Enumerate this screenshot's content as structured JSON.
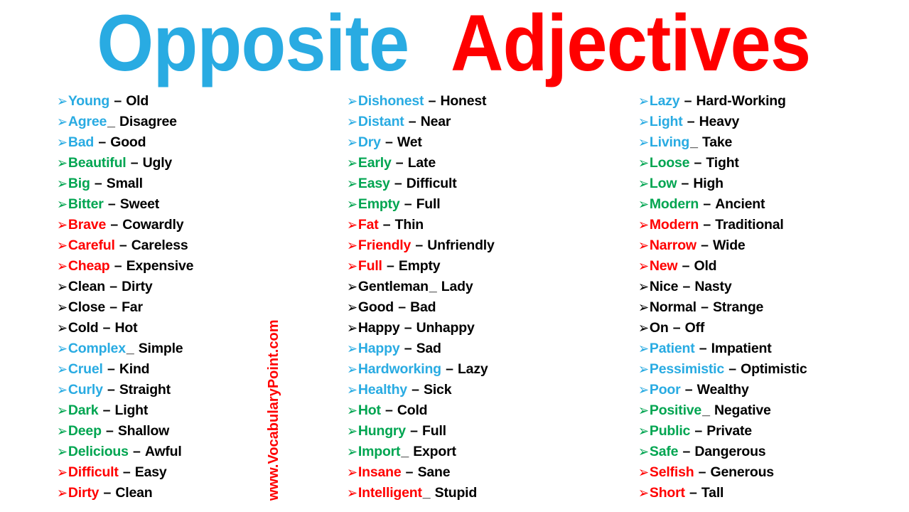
{
  "title": {
    "word_first": "Opposite",
    "word_second": "Adjectives",
    "color_first": "#29ABE2",
    "color_second": "#FF0000"
  },
  "watermark": {
    "text": "www.VocabularyPoint.com",
    "color": "#FF0000"
  },
  "bullet_glyph": "➢",
  "palette": {
    "blue": "#29ABE2",
    "green": "#00A551",
    "red": "#FF0000",
    "black": "#000000"
  },
  "columns": [
    {
      "name": "column-1",
      "rows": [
        {
          "word": "Young",
          "sep": "–",
          "opposite": "Old",
          "color": "blue"
        },
        {
          "word": "Agree",
          "sep": "_",
          "opposite": "Disagree",
          "color": "blue"
        },
        {
          "word": "Bad",
          "sep": "–",
          "opposite": "Good",
          "color": "blue"
        },
        {
          "word": "Beautiful",
          "sep": "–",
          "opposite": "Ugly",
          "color": "green"
        },
        {
          "word": "Big",
          "sep": "–",
          "opposite": "Small",
          "color": "green"
        },
        {
          "word": "Bitter",
          "sep": "–",
          "opposite": "Sweet",
          "color": "green"
        },
        {
          "word": "Brave",
          "sep": "–",
          "opposite": "Cowardly",
          "color": "red"
        },
        {
          "word": "Careful",
          "sep": "–",
          "opposite": "Careless",
          "color": "red"
        },
        {
          "word": "Cheap",
          "sep": "–",
          "opposite": "Expensive",
          "color": "red"
        },
        {
          "word": "Clean",
          "sep": "–",
          "opposite": "Dirty",
          "color": "black"
        },
        {
          "word": "Close",
          "sep": "–",
          "opposite": "Far",
          "color": "black"
        },
        {
          "word": "Cold",
          "sep": "–",
          "opposite": "Hot",
          "color": "black"
        },
        {
          "word": "Complex",
          "sep": "_",
          "opposite": "Simple",
          "color": "blue"
        },
        {
          "word": "Cruel",
          "sep": "–",
          "opposite": "Kind",
          "color": "blue"
        },
        {
          "word": "Curly",
          "sep": "–",
          "opposite": "Straight",
          "color": "blue"
        },
        {
          "word": "Dark",
          "sep": "–",
          "opposite": "Light",
          "color": "green"
        },
        {
          "word": "Deep",
          "sep": "–",
          "opposite": "Shallow",
          "color": "green"
        },
        {
          "word": "Delicious",
          "sep": "–",
          "opposite": "Awful",
          "color": "green"
        },
        {
          "word": "Difficult",
          "sep": "–",
          "opposite": "Easy",
          "color": "red"
        },
        {
          "word": "Dirty",
          "sep": "–",
          "opposite": "Clean",
          "color": "red"
        }
      ]
    },
    {
      "name": "column-2",
      "rows": [
        {
          "word": "Dishonest",
          "sep": "–",
          "opposite": "Honest",
          "color": "blue"
        },
        {
          "word": "Distant",
          "sep": "–",
          "opposite": "Near",
          "color": "blue"
        },
        {
          "word": "Dry",
          "sep": "–",
          "opposite": "Wet",
          "color": "blue"
        },
        {
          "word": "Early",
          "sep": "–",
          "opposite": "Late",
          "color": "green"
        },
        {
          "word": "Easy",
          "sep": "–",
          "opposite": "Difficult",
          "color": "green"
        },
        {
          "word": "Empty",
          "sep": "–",
          "opposite": "Full",
          "color": "green"
        },
        {
          "word": "Fat",
          "sep": "–",
          "opposite": "Thin",
          "color": "red"
        },
        {
          "word": "Friendly",
          "sep": "–",
          "opposite": "Unfriendly",
          "color": "red"
        },
        {
          "word": "Full",
          "sep": "–",
          "opposite": "Empty",
          "color": "red"
        },
        {
          "word": "Gentleman",
          "sep": "_",
          "opposite": "Lady",
          "color": "black"
        },
        {
          "word": "Good",
          "sep": "–",
          "opposite": "Bad",
          "color": "black"
        },
        {
          "word": "Happy",
          "sep": "–",
          "opposite": "Unhappy",
          "color": "black"
        },
        {
          "word": "Happy",
          "sep": "–",
          "opposite": "Sad",
          "color": "blue"
        },
        {
          "word": "Hardworking",
          "sep": "–",
          "opposite": "Lazy",
          "color": "blue"
        },
        {
          "word": "Healthy",
          "sep": "–",
          "opposite": "Sick",
          "color": "blue"
        },
        {
          "word": "Hot",
          "sep": "–",
          "opposite": "Cold",
          "color": "green"
        },
        {
          "word": "Hungry",
          "sep": "–",
          "opposite": "Full",
          "color": "green"
        },
        {
          "word": "Import",
          "sep": "_",
          "opposite": "Export",
          "color": "green"
        },
        {
          "word": "Insane",
          "sep": "–",
          "opposite": "Sane",
          "color": "red"
        },
        {
          "word": "Intelligent",
          "sep": "_",
          "opposite": "Stupid",
          "color": "red"
        }
      ]
    },
    {
      "name": "column-3",
      "rows": [
        {
          "word": "Lazy",
          "sep": "–",
          "opposite": "Hard-Working",
          "color": "blue"
        },
        {
          "word": "Light",
          "sep": "–",
          "opposite": "Heavy",
          "color": "blue"
        },
        {
          "word": "Living",
          "sep": "_",
          "opposite": "Take",
          "color": "blue"
        },
        {
          "word": "Loose",
          "sep": "–",
          "opposite": "Tight",
          "color": "green"
        },
        {
          "word": "Low",
          "sep": "–",
          "opposite": "High",
          "color": "green"
        },
        {
          "word": "Modern",
          "sep": "–",
          "opposite": "Ancient",
          "color": "green"
        },
        {
          "word": "Modern",
          "sep": "–",
          "opposite": "Traditional",
          "color": "red"
        },
        {
          "word": "Narrow",
          "sep": "–",
          "opposite": "Wide",
          "color": "red"
        },
        {
          "word": "New",
          "sep": "–",
          "opposite": "Old",
          "color": "red"
        },
        {
          "word": "Nice",
          "sep": "–",
          "opposite": "Nasty",
          "color": "black"
        },
        {
          "word": "Normal",
          "sep": "–",
          "opposite": "Strange",
          "color": "black"
        },
        {
          "word": "On",
          "sep": "–",
          "opposite": "Off",
          "color": "black"
        },
        {
          "word": "Patient",
          "sep": "–",
          "opposite": "Impatient",
          "color": "blue"
        },
        {
          "word": "Pessimistic",
          "sep": "–",
          "opposite": "Optimistic",
          "color": "blue"
        },
        {
          "word": "Poor",
          "sep": "–",
          "opposite": "Wealthy",
          "color": "blue"
        },
        {
          "word": "Positive",
          "sep": "_",
          "opposite": "Negative",
          "color": "green"
        },
        {
          "word": "Public",
          "sep": "–",
          "opposite": "Private",
          "color": "green"
        },
        {
          "word": "Safe",
          "sep": "–",
          "opposite": "Dangerous",
          "color": "green"
        },
        {
          "word": "Selfish",
          "sep": "–",
          "opposite": "Generous",
          "color": "red"
        },
        {
          "word": "Short",
          "sep": "–",
          "opposite": "Tall",
          "color": "red"
        }
      ]
    }
  ]
}
